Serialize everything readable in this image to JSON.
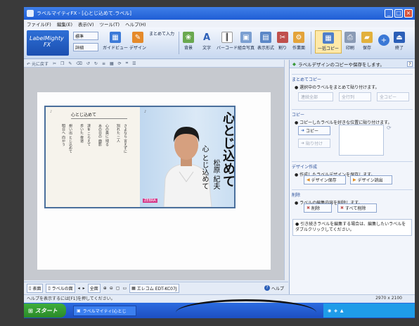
{
  "window": {
    "title": "ラベルマイティFX - [心とじ込めて.ラベル]"
  },
  "menu": [
    "ファイル(F)",
    "編集(E)",
    "表示(V)",
    "ツール(T)",
    "ヘルプ(H)"
  ],
  "ribbon": {
    "logo_line1": "LabelMighty",
    "logo_line2": "FX",
    "view_buttons": [
      "標準",
      "詳細"
    ],
    "guide_label": "ガイドビュー",
    "design_label": "デザイン",
    "group_label": "まとめて入力",
    "tools": [
      "背景",
      "文字",
      "バーコード",
      "組合写真",
      "表示形式",
      "割り",
      "作業面"
    ],
    "right_tools": [
      "一括コピー",
      "印刷",
      "保存",
      "終了"
    ]
  },
  "toolbar2": {
    "undo": "元に戻す"
  },
  "label": {
    "song_title": "心とじ込めて",
    "artist": "松原 紀夫",
    "subtitle": "心\nとじ込めて",
    "badge": "ZEBRA",
    "left_small_title": "心とじ込めて",
    "lyrics": [
      "さよなら 言えずに",
      "別れた 二人",
      "心の奥に 残る",
      "あの日の 面影",
      "涙を こらえて",
      "歩いた 夜道",
      "想い出 とじ込めて",
      "明日へ 向かう"
    ]
  },
  "bottombar": {
    "front": "表面",
    "labelface": "ラベルの面",
    "zoom_label": "全面",
    "product": "エレコム EDT-KC07J",
    "help": "ヘルプ"
  },
  "statusbar": {
    "left": "ヘルプを表示するには[F1]を押してください。",
    "size": "2970 x 2100"
  },
  "taskbar": {
    "start": "スタート",
    "task": "ラベルマイティ(心とじ"
  },
  "panel": {
    "header": "ラベルデザインのコピーや保存をします。",
    "group_copy_title": "まとめてコピー",
    "group_copy_desc": "● 選択中のラベルをまとめて貼り付けます。",
    "group_copy_btns": [
      "連続全部",
      "全行列",
      "全コピー"
    ],
    "copy_title": "コピー",
    "copy_desc": "● コピーしたラベルを好きな位置に貼り付けます。",
    "copy_btn": "コピー",
    "paste_btn": "貼り付け",
    "design_title": "デザイン作成",
    "design_desc": "● 作成したラベルデザインを保存します。",
    "design_save": "デザイン保存",
    "design_read": "デザイン読出",
    "delete_title": "削除",
    "delete_desc": "● ラベルの編集内容を削除します。",
    "delete_btn": "削除",
    "delete_all_btn": "すべて削除",
    "info": "● 引き続きラベルを編集する場合は、編集したいラベルをダブルクリックしてください。"
  },
  "colors": {
    "accent": "#1f5ed6",
    "panel_title": "#2a4f9a",
    "label_border": "#4a6f9c"
  }
}
